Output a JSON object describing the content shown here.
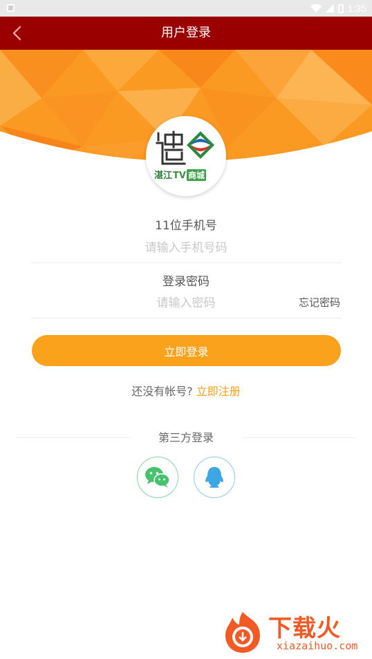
{
  "status_bar": {
    "time": "1:35"
  },
  "header": {
    "title": "用户登录"
  },
  "logo": {
    "line1": "湛江",
    "line2": "TV",
    "line3": "商城"
  },
  "phone": {
    "label": "11位手机号",
    "placeholder": "请输入手机号码"
  },
  "password": {
    "label": "登录密码",
    "placeholder": "请输入密码",
    "forgot": "忘记密码"
  },
  "login_button": "立即登录",
  "register": {
    "question": "还没有帐号?",
    "link": "立即注册"
  },
  "third_party": {
    "label": "第三方登录",
    "providers": [
      "wechat",
      "qq"
    ]
  },
  "watermark": {
    "brand": "下载火",
    "url": "xiazaihuo.com"
  },
  "colors": {
    "header_bg": "#9b0000",
    "accent": "#fba21c",
    "link": "#f5a01a",
    "wechat": "#46c26f",
    "qq": "#3ea6e3"
  }
}
